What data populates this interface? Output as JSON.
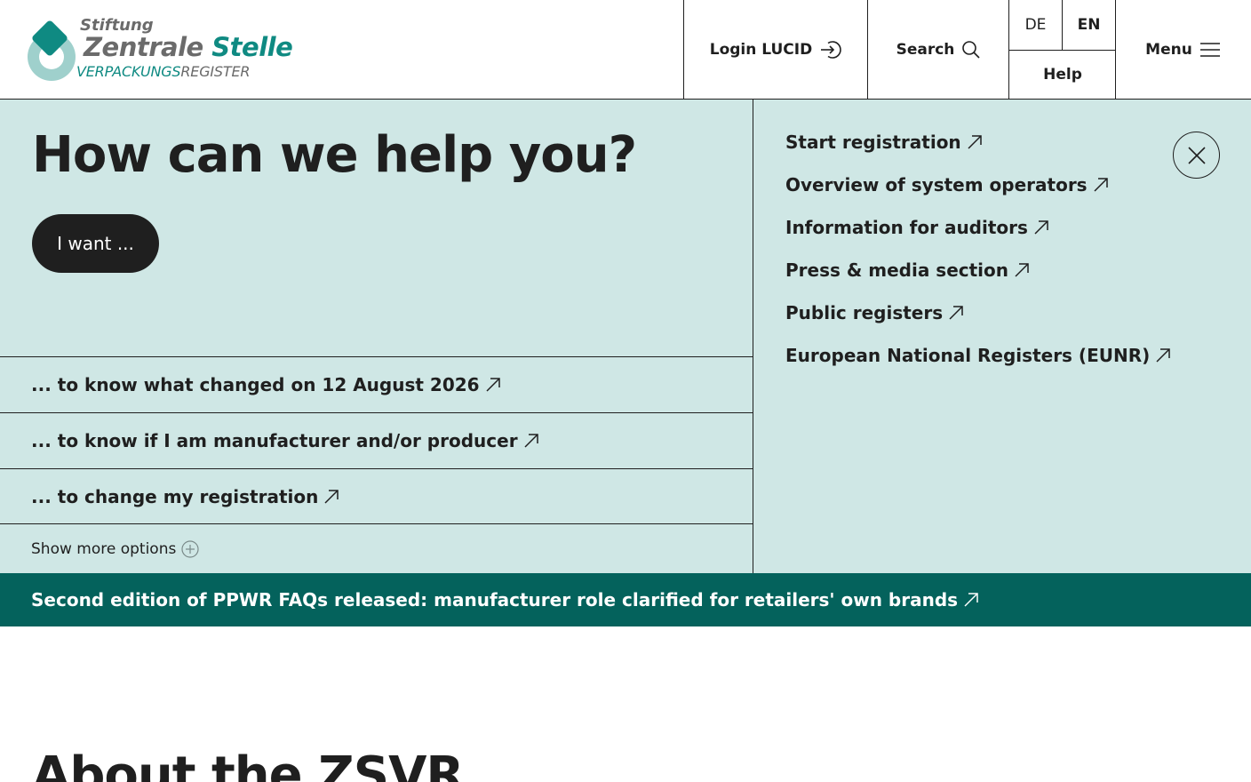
{
  "header": {
    "logo": {
      "line1": "Stiftung",
      "line2a": "Zentrale",
      "line2b": "Stelle",
      "line3a": "VERPACKUNGS",
      "line3b": "REGISTER"
    },
    "login_label": "Login LUCID",
    "search_label": "Search",
    "lang_de": "DE",
    "lang_en": "EN",
    "help_label": "Help",
    "menu_label": "Menu"
  },
  "help": {
    "title": "How can we help you?",
    "want_button": "I want ...",
    "options": [
      "... to know what changed on 12 August 2026",
      "... to know if I am manufacturer and/or producer",
      "... to change my registration"
    ],
    "show_more": "Show more options",
    "quick_links": [
      "Start registration",
      "Overview of system operators",
      "Information for auditors",
      "Press & media section",
      "Public registers",
      "European National Registers (EUNR)"
    ]
  },
  "news": {
    "text": "Second edition of PPWR FAQs released: manufacturer role clarified for retailers' own brands"
  },
  "about": {
    "title": "About the ZSVR"
  },
  "colors": {
    "teal_bg": "#cfe7e5",
    "news_bg": "#04625c",
    "brand_teal": "#0f8a82",
    "dark": "#1f1f1f"
  },
  "icons": {
    "external": "arrow-up-right-icon",
    "login": "login-arrow-icon",
    "search": "search-icon",
    "menu": "hamburger-icon",
    "close": "close-icon",
    "plus": "plus-circle-icon"
  }
}
